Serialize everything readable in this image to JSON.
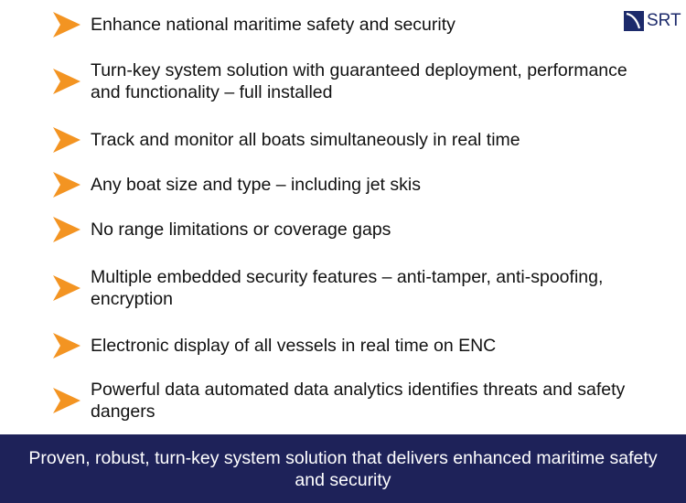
{
  "logo": {
    "text": "SRT",
    "icon": "srt-logo-swoosh-icon",
    "color": "#1c2a6b"
  },
  "bullets": [
    {
      "icon": "orange-arrow-bullet-icon",
      "text": "Enhance national maritime safety and security"
    },
    {
      "icon": "orange-arrow-bullet-icon",
      "text": "Turn-key system solution with guaranteed deployment, performance and functionality – full installed"
    },
    {
      "icon": "orange-arrow-bullet-icon",
      "text": "Track and monitor all boats simultaneously in real time"
    },
    {
      "icon": "orange-arrow-bullet-icon",
      "text": "Any boat size and type – including jet skis"
    },
    {
      "icon": "orange-arrow-bullet-icon",
      "text": "No range limitations or coverage gaps"
    },
    {
      "icon": "orange-arrow-bullet-icon",
      "text": "Multiple embedded security features – anti-tamper, anti-spoofing, encryption"
    },
    {
      "icon": "orange-arrow-bullet-icon",
      "text": "Electronic display of all vessels in real time on ENC"
    },
    {
      "icon": "orange-arrow-bullet-icon",
      "text": "Powerful data automated data analytics identifies threats and safety dangers"
    }
  ],
  "footer": {
    "text": "Proven, robust, turn-key system solution that delivers enhanced maritime safety and security",
    "background": "#1e2259"
  },
  "colors": {
    "arrow": "#f39422",
    "text": "#111111"
  }
}
